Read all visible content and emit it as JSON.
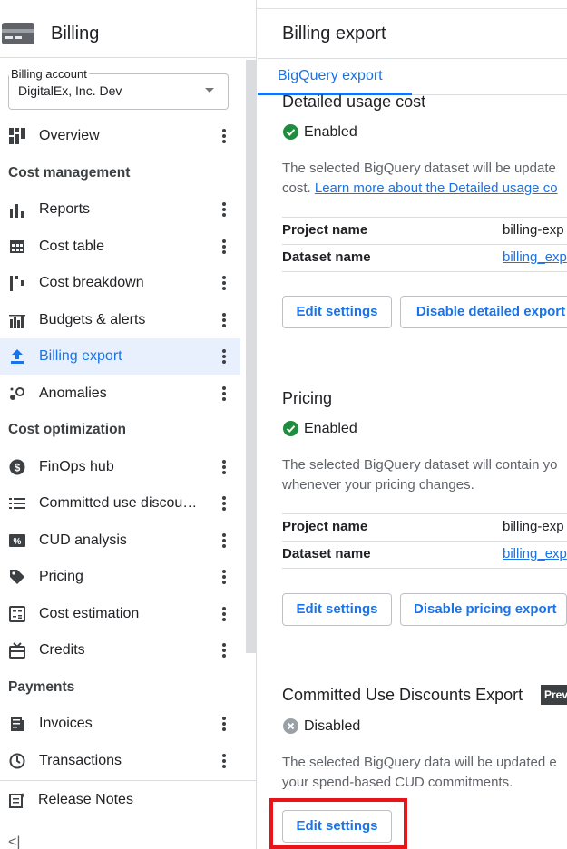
{
  "app": {
    "product_title": "Billing",
    "page_title": "Billing export"
  },
  "billing_account": {
    "label": "Billing account",
    "value": "DigitalEx, Inc. Dev"
  },
  "sidebar": {
    "overview": "Overview",
    "sections": [
      {
        "title": "Cost management",
        "items": [
          "Reports",
          "Cost table",
          "Cost breakdown",
          "Budgets & alerts",
          "Billing export",
          "Anomalies"
        ]
      },
      {
        "title": "Cost optimization",
        "items": [
          "FinOps hub",
          "Committed use discou…",
          "CUD analysis",
          "Pricing",
          "Cost estimation",
          "Credits"
        ]
      },
      {
        "title": "Payments",
        "items": [
          "Invoices",
          "Transactions"
        ]
      }
    ],
    "active_item": "Billing export",
    "release_notes": "Release Notes",
    "collapse_icon": "<|"
  },
  "tabs": [
    {
      "label": "BigQuery export",
      "selected": true
    }
  ],
  "sections": {
    "detailed": {
      "title": "Detailed usage cost",
      "status": "Enabled",
      "desc_line1": "The selected BigQuery dataset will be update",
      "desc_line2_prefix": "cost. ",
      "desc_link": "Learn more about the Detailed usage co",
      "project_key": "Project name",
      "project_val": "billing-exp",
      "dataset_key": "Dataset name",
      "dataset_val": "billing_exp",
      "edit_label": "Edit settings",
      "disable_label": "Disable detailed export"
    },
    "pricing": {
      "title": "Pricing",
      "status": "Enabled",
      "desc_line1": "The selected BigQuery dataset will contain yo",
      "desc_line2": "whenever your pricing changes.",
      "project_key": "Project name",
      "project_val": "billing-exp",
      "dataset_key": "Dataset name",
      "dataset_val": "billing_exp",
      "edit_label": "Edit settings",
      "disable_label": "Disable pricing export"
    },
    "cud": {
      "title": "Committed Use Discounts Export",
      "badge": "Prev",
      "status": "Disabled",
      "desc_line1": "The selected BigQuery data will be updated e",
      "desc_line2": "your spend-based CUD commitments.",
      "edit_label": "Edit settings"
    }
  },
  "colors": {
    "accent": "#1a73e8",
    "enabled": "#1e8e3e",
    "disabled": "#9aa0a6",
    "highlight": "#e8141a"
  }
}
